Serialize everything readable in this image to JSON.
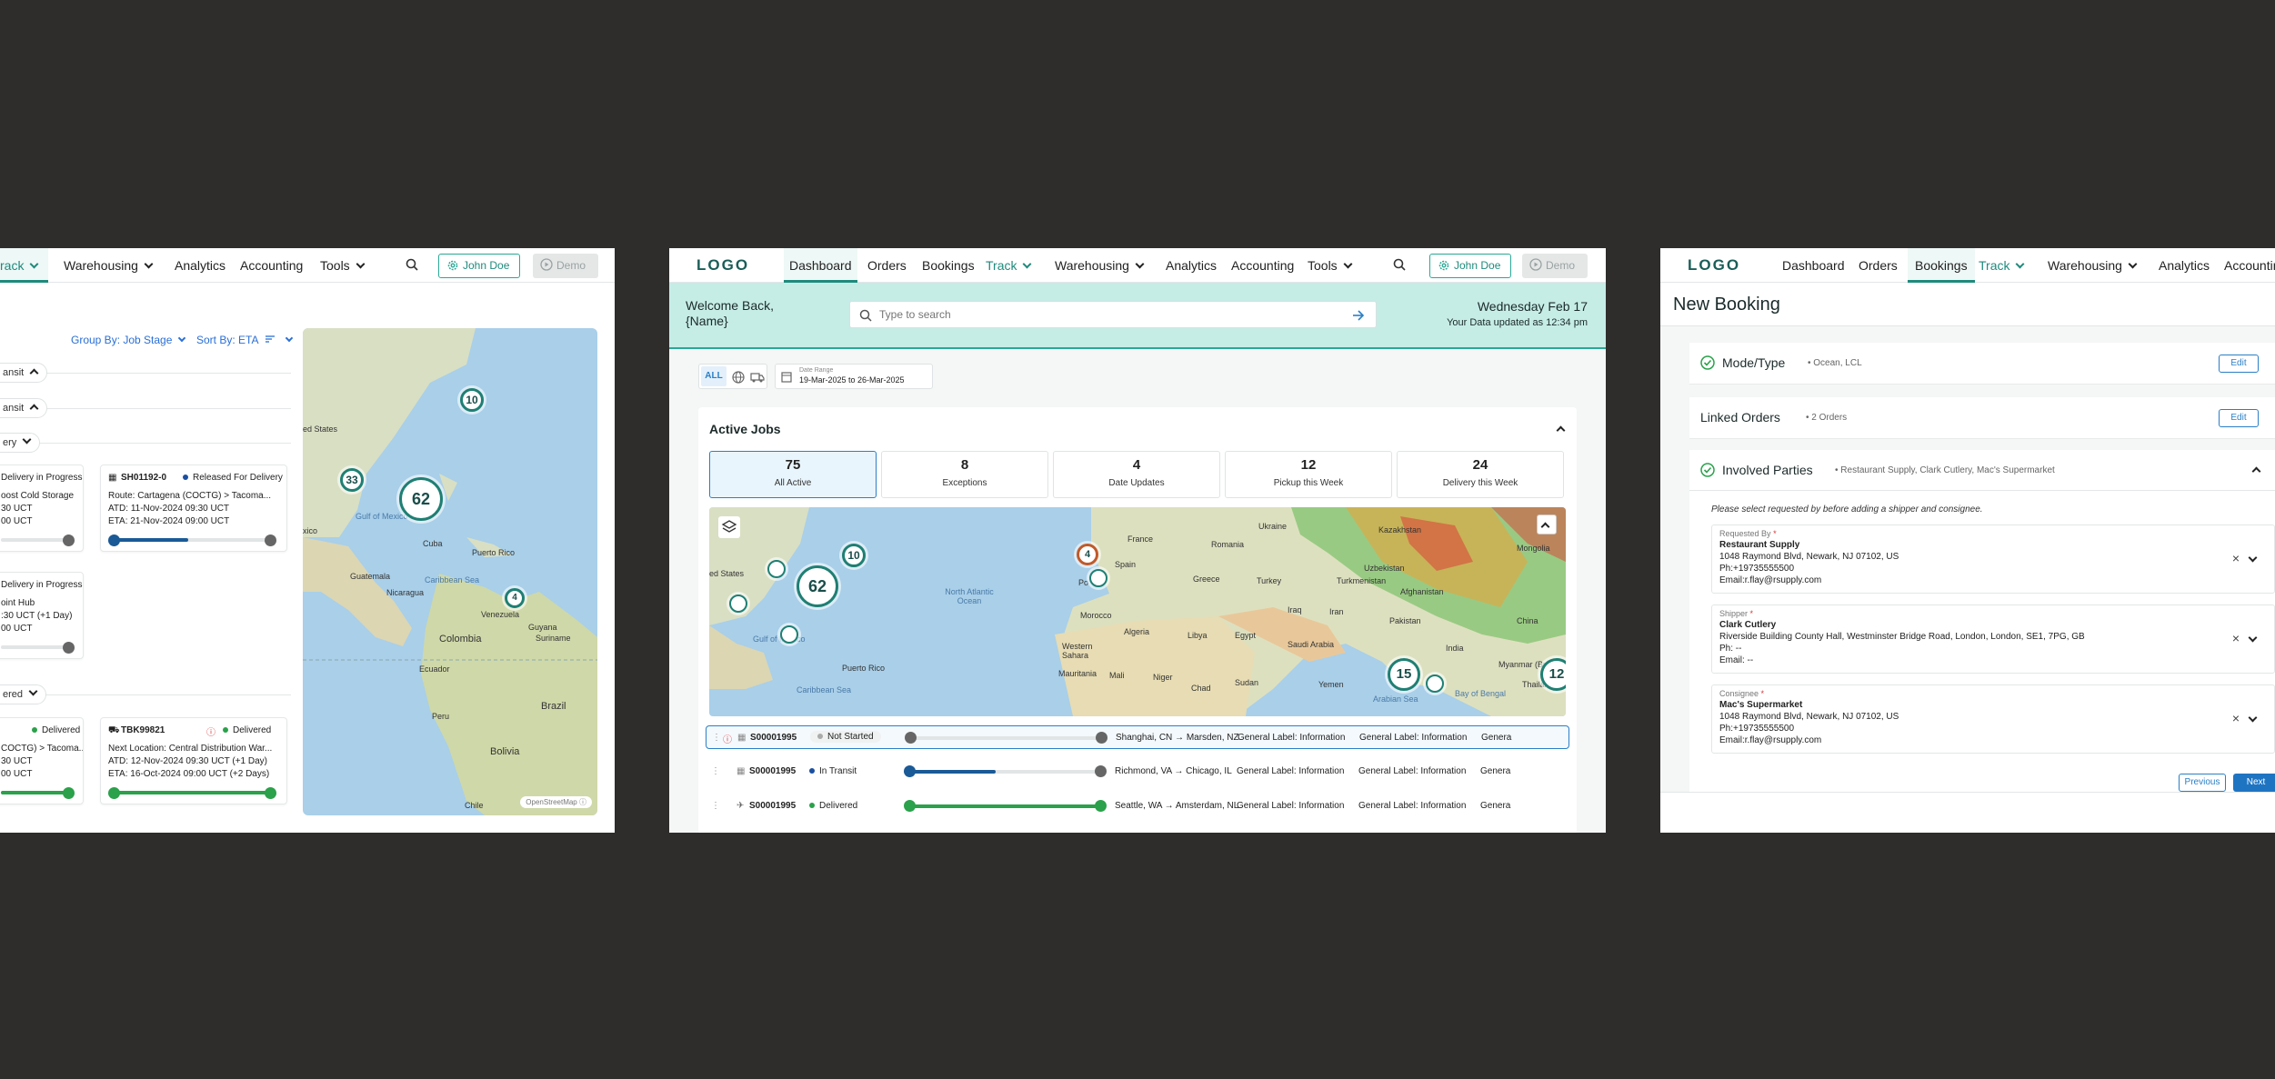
{
  "left": {
    "nav": {
      "items": [
        "rack",
        "Warehousing",
        "Analytics",
        "Accounting",
        "Tools"
      ],
      "user": "John Doe",
      "demo": "Demo"
    },
    "toolbar": {
      "group_by": "Group By: Job Stage",
      "sort_by": "Sort By: ETA"
    },
    "stages": [
      "ansit",
      "ansit",
      "ery",
      "ered"
    ],
    "cards": [
      {
        "l1": "Delivery in Progress",
        "l2": "oost Cold Storage",
        "l3": "30 UCT",
        "l4": "00 UCT"
      },
      {
        "id": "SH01192-0",
        "status": "Released For Delivery",
        "l1": "Route: Cartagena (COCTG) > Tacoma...",
        "l2": "ATD: 11-Nov-2024 09:30 UCT",
        "l3": "ETA: 21-Nov-2024 09:00 UCT"
      },
      {
        "l1": "Delivery in Progress",
        "l2": "oint Hub",
        "l3": ":30 UCT (+1 Day)",
        "l4": "00 UCT"
      },
      {
        "status": "Delivered",
        "l1": "COCTG) > Tacoma...",
        "l2": "30 UCT",
        "l3": "00 UCT"
      },
      {
        "id": "TBK99821",
        "status": "Delivered",
        "l1": "Next Location: Central Distribution War...",
        "l2": "ATD: 12-Nov-2024 09:30 UCT (+1 Day)",
        "l3": "ETA: 16-Oct-2024 09:00 UCT (+2 Days)"
      }
    ],
    "map": {
      "clusters": [
        "10",
        "33",
        "62",
        "4"
      ],
      "labels": [
        "ed States",
        "Gulf of Mexico",
        "xico",
        "Cuba",
        "Puerto Rico",
        "Caribbean Sea",
        "Guatemala",
        "Nicaragua",
        "Venezuela",
        "Guyana",
        "Suriname",
        "Colombia",
        "Ecuador",
        "Peru",
        "Brazil",
        "Bolivia",
        "Chile"
      ],
      "attribution": "OpenStreetMap"
    }
  },
  "mid": {
    "nav": {
      "logo": "LOGO",
      "items": [
        "Dashboard",
        "Orders",
        "Bookings",
        "Track",
        "Warehousing",
        "Analytics",
        "Accounting",
        "Tools"
      ],
      "user": "John Doe",
      "demo": "Demo"
    },
    "welcome": {
      "greeting": "Welcome Back, {Name}",
      "search_placeholder": "Type to search",
      "date": "Wednesday Feb 17",
      "updated": "Your Data updated as 12:34 pm"
    },
    "filters": {
      "all": "ALL",
      "date_range_label": "Date Range",
      "date_range": "19-Mar-2025 to 26-Mar-2025"
    },
    "jobs": {
      "title": "Active Jobs",
      "stats": [
        {
          "n": "75",
          "l": "All Active"
        },
        {
          "n": "8",
          "l": "Exceptions"
        },
        {
          "n": "4",
          "l": "Date Updates"
        },
        {
          "n": "12",
          "l": "Pickup this Week"
        },
        {
          "n": "24",
          "l": "Delivery this Week"
        }
      ],
      "map": {
        "clusters": [
          "10",
          "62",
          "4",
          "15",
          "12"
        ],
        "labels": [
          "ed States",
          "Gulf of Mexico",
          "Puerto Rico",
          "Caribbean Sea",
          "North Atlantic Ocean",
          "France",
          "Spain",
          "Po",
          "Morocco",
          "Algeria",
          "Libya",
          "Egypt",
          "Western Sahara",
          "Mauritania",
          "Mali",
          "Niger",
          "Chad",
          "Sudan",
          "Romania",
          "Greece",
          "Turkey",
          "Ukraine",
          "Kazakhstan",
          "Uzbekistan",
          "Turkmenistan",
          "Iraq",
          "Iran",
          "Saudi Arabia",
          "Yemen",
          "Arabian Sea",
          "Afghanistan",
          "Pakistan",
          "India",
          "Myanmar (Burma)",
          "Bay of Bengal",
          "Thailand",
          "China",
          "Mongolia"
        ]
      },
      "rows": [
        {
          "id": "S00001995",
          "status": "Not Started",
          "route": "Shanghai, CN → Marsden, NZ",
          "progress": 0
        },
        {
          "id": "S00001995",
          "status": "In Transit",
          "route": "Richmond, VA → Chicago, IL",
          "progress": 0.45
        },
        {
          "id": "S00001995",
          "status": "Delivered",
          "route": "Seattle, WA → Amsterdam, NL",
          "progress": 1
        }
      ],
      "row_cols": [
        "General Label: Information",
        "General Label: Information",
        "Genera"
      ]
    }
  },
  "right": {
    "nav": {
      "logo": "LOGO",
      "items": [
        "Dashboard",
        "Orders",
        "Bookings",
        "Track",
        "Warehousing",
        "Analytics",
        "Accountin"
      ]
    },
    "title": "New Booking",
    "sections": {
      "mode": {
        "title": "Mode/Type",
        "summary": "• Ocean, LCL",
        "edit": "Edit"
      },
      "linked": {
        "title": "Linked Orders",
        "summary": "• 2 Orders",
        "edit": "Edit"
      },
      "parties": {
        "title": "Involved Parties",
        "summary": "• Restaurant Supply, Clark Cutlery, Mac's Supermarket"
      }
    },
    "instruction": "Please select requested by before adding a shipper and consignee.",
    "fields": [
      {
        "label": "Requested By",
        "lines": [
          "Restaurant Supply",
          "1048 Raymond Blvd, Newark, NJ 07102, US",
          "Ph:+19735555500",
          "Email:r.flay@rsupply.com"
        ]
      },
      {
        "label": "Shipper",
        "lines": [
          "Clark Cutlery",
          "Riverside Building County Hall, Westminster Bridge Road, London, London, SE1, 7PG, GB",
          "Ph: --",
          "Email: --"
        ]
      },
      {
        "label": "Consignee",
        "lines": [
          "Mac's Supermarket",
          "1048 Raymond Blvd, Newark, NJ 07102, US",
          "Ph:+19735555500",
          "Email:r.flay@rsupply.com"
        ]
      }
    ],
    "buttons": {
      "previous": "Previous",
      "next": "Next"
    }
  },
  "colors": {
    "brand": "#1f8a7c",
    "accent_blue": "#2a7fc6",
    "welcome_bg": "#c6ece6",
    "progress_blue": "#1a5a96",
    "progress_green": "#2aa14a"
  }
}
